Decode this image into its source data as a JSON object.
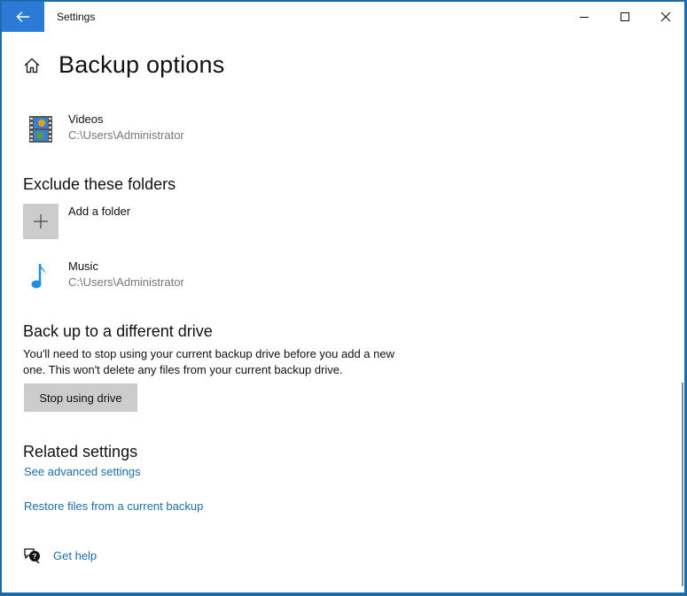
{
  "window": {
    "title": "Settings",
    "controls": {
      "minimize": "minimize-icon",
      "maximize": "maximize-icon",
      "close": "close-icon"
    }
  },
  "header": {
    "title": "Backup options",
    "home_icon": "home-icon",
    "back_icon": "back-arrow-icon"
  },
  "back_up_folders": {
    "items": [
      {
        "name": "Videos",
        "path": "C:\\Users\\Administrator",
        "icon": "videos-folder-icon"
      }
    ]
  },
  "exclude": {
    "title": "Exclude these folders",
    "add_label": "Add a folder",
    "items": [
      {
        "name": "Music",
        "path": "C:\\Users\\Administrator",
        "icon": "music-note-icon"
      }
    ]
  },
  "different_drive": {
    "title": "Back up to a different drive",
    "description": "You'll need to stop using your current backup drive before you add a new one. This won't delete any files from your current backup drive.",
    "button_label": "Stop using drive"
  },
  "related": {
    "title": "Related settings",
    "links": [
      "See advanced settings",
      "Restore files from a current backup"
    ]
  },
  "help": {
    "label": "Get help",
    "icon": "help-chat-icon"
  },
  "colors": {
    "accent": "#2b7bd6",
    "link": "#1a6fa8",
    "border": "#1c6fb5"
  }
}
